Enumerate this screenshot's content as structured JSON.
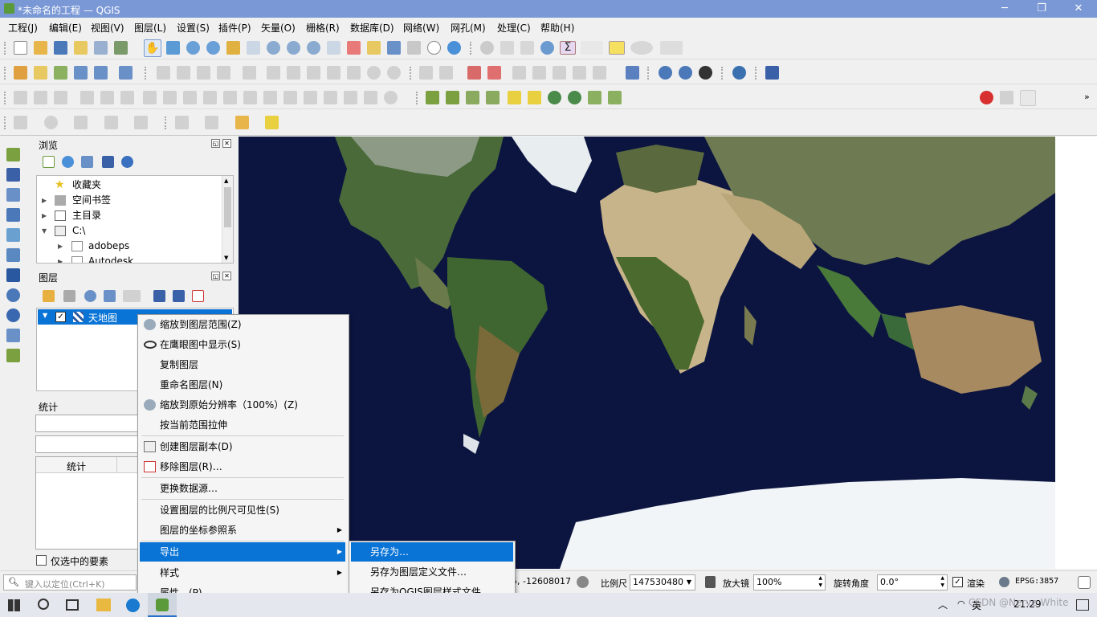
{
  "window": {
    "title": "*未命名的工程 — QGIS",
    "minimize": "─",
    "maximize": "❐",
    "close": "✕"
  },
  "menu": [
    "工程(J)",
    "编辑(E)",
    "视图(V)",
    "图层(L)",
    "设置(S)",
    "插件(P)",
    "矢量(O)",
    "栅格(R)",
    "数据库(D)",
    "网络(W)",
    "网孔(M)",
    "处理(C)",
    "帮助(H)"
  ],
  "browser_panel": {
    "title": "浏览",
    "items": [
      {
        "label": "收藏夹",
        "icon": "star-icon"
      },
      {
        "label": "空间书签",
        "icon": "bookmark-icon"
      },
      {
        "label": "主目录",
        "icon": "home-icon"
      },
      {
        "label": "C:\\",
        "icon": "drive-icon"
      },
      {
        "label": "adobeps",
        "icon": "folder-icon"
      },
      {
        "label": "Autodesk",
        "icon": "folder-icon"
      }
    ]
  },
  "layers_panel": {
    "title": "图层",
    "layer": {
      "name": "天地图",
      "checked": true
    }
  },
  "stats_panel": {
    "title": "统计",
    "column": "统计",
    "selected_only": "仅选中的要素"
  },
  "context_menu": {
    "items": [
      "缩放到图层范围(Z)",
      "在鹰眼图中显示(S)",
      "复制图层",
      "重命名图层(N)",
      "缩放到原始分辨率（100%）(Z)",
      "按当前范围拉伸",
      "创建图层副本(D)",
      "移除图层(R)…",
      "更换数据源…",
      "设置图层的比例尺可见性(S)",
      "图层的坐标参照系",
      "导出",
      "样式",
      "属性…(P)"
    ],
    "highlighted": "导出"
  },
  "export_submenu": {
    "items": [
      "另存为…",
      "另存为图层定义文件…",
      "另存为QGIS图层样式文件…"
    ],
    "highlighted": "另存为…"
  },
  "statusbar": {
    "locate_placeholder": "键入以定位(Ctrl+K)",
    "coordinate": "5, -12608017",
    "scale_label": "比例尺",
    "scale": "147530480",
    "magnifier_label": "放大镜",
    "magnifier": "100%",
    "rotation_label": "旋转角度",
    "rotation": "0.0°",
    "render_label": "渲染",
    "crs": "EPSG:3857"
  },
  "taskbar": {
    "ime": "英",
    "time": "21:29",
    "watermark": "CSDN @Nerve White"
  },
  "colors": {
    "titlebar": "#7a98d6",
    "highlight": "#0a74d6",
    "ocean": "#0c1540"
  }
}
